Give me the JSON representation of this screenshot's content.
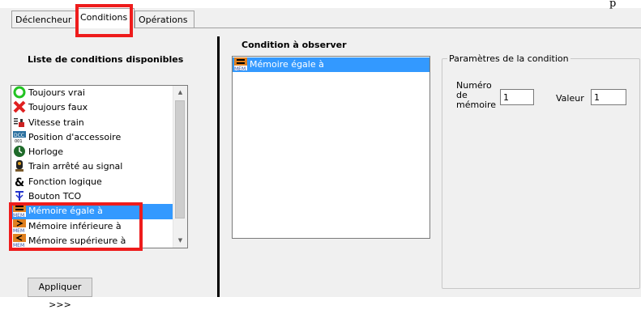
{
  "corner_text": "p",
  "tabs": [
    {
      "label": "Déclencheur"
    },
    {
      "label": "Conditions"
    },
    {
      "label": "Opérations"
    }
  ],
  "left_panel": {
    "heading": "Liste de conditions disponibles",
    "items": [
      {
        "label": "Toujours vrai",
        "icon": "green-circle-icon"
      },
      {
        "label": "Toujours faux",
        "icon": "red-cross-icon"
      },
      {
        "label": "Vitesse train",
        "icon": "speed-train-icon"
      },
      {
        "label": "Position d'accessoire",
        "icon": "dcc-accessory-icon"
      },
      {
        "label": "Horloge",
        "icon": "clock-icon"
      },
      {
        "label": "Train arrêté au signal",
        "icon": "signal-icon"
      },
      {
        "label": "Fonction logique",
        "icon": "ampersand-icon"
      },
      {
        "label": "Bouton TCO",
        "icon": "tco-button-icon"
      },
      {
        "label": "Mémoire égale à",
        "icon": "memory-equal-icon",
        "selected": true
      },
      {
        "label": "Mémoire inférieure à",
        "icon": "memory-less-icon"
      },
      {
        "label": "Mémoire supérieure à",
        "icon": "memory-greater-icon"
      }
    ],
    "apply_button": "Appliquer >>>"
  },
  "middle_panel": {
    "heading": "Condition à observer",
    "items": [
      {
        "label": "Mémoire égale à",
        "icon": "memory-equal-icon",
        "selected": true
      }
    ]
  },
  "params": {
    "legend": "Paramètres de la condition",
    "memory_number_label": "Numéro\nde\nmémoire",
    "memory_number_value": "1",
    "value_label": "Valeur",
    "value_value": "1"
  },
  "colors": {
    "highlight": "#ee1c1c",
    "selection": "#3399ff"
  }
}
